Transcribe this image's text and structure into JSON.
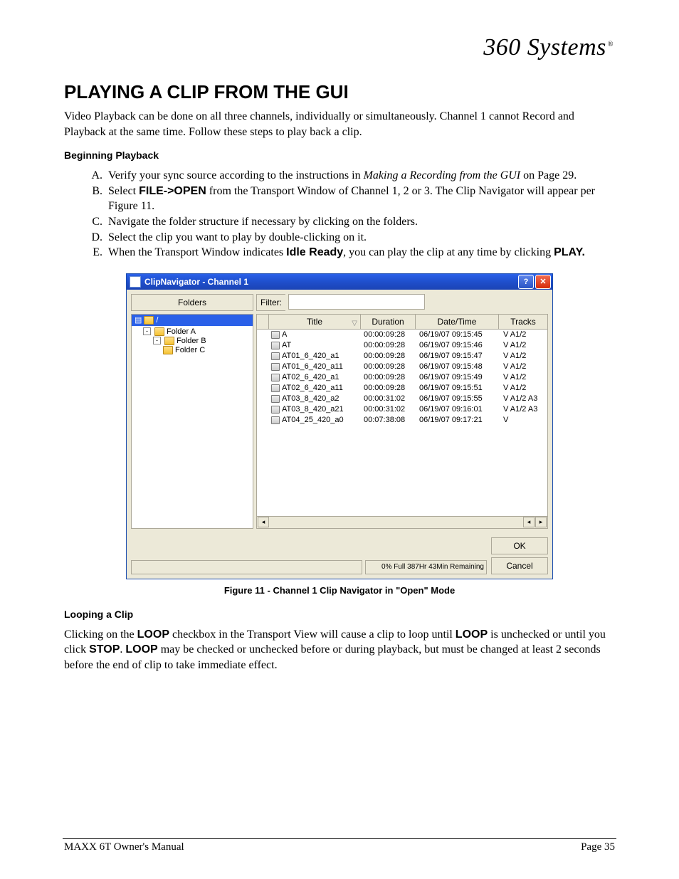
{
  "brand": "360 Systems",
  "heading": "PLAYING A CLIP FROM THE GUI",
  "intro": "Video Playback can be done on all three channels, individually or simultaneously. Channel 1 cannot Record and Playback at the same time.  Follow these steps to play back a clip.",
  "sub_begin": "Beginning Playback",
  "steps": {
    "a1": "Verify your sync source according to the instructions in ",
    "a_em": "Making a Recording from the GUI",
    "a2": " on Page 29.",
    "b1": "Select  ",
    "b_bold": "FILE->OPEN",
    "b2": " from the Transport Window of Channel 1, 2 or 3. The Clip Navigator will appear per Figure 11.",
    "c": "Navigate the folder structure if necessary by clicking on the folders.",
    "d": "Select the clip you want to play by double-clicking on it.",
    "e1": "When the Transport Window indicates ",
    "e_bold1": "Idle Ready",
    "e2": ", you can play the clip at any time by clicking ",
    "e_bold2": "PLAY."
  },
  "dialog": {
    "title": "ClipNavigator - Channel 1",
    "folders_label": "Folders",
    "filter_label": "Filter:",
    "columns": {
      "title": "Title",
      "duration": "Duration",
      "datetime": "Date/Time",
      "tracks": "Tracks"
    },
    "tree": {
      "a": "Folder A",
      "b": "Folder B",
      "c": "Folder C"
    },
    "rows": [
      {
        "title": "A",
        "duration": "00:00:09:28",
        "datetime": "06/19/07 09:15:45",
        "tracks": "V A1/2"
      },
      {
        "title": "AT",
        "duration": "00:00:09:28",
        "datetime": "06/19/07 09:15:46",
        "tracks": "V A1/2"
      },
      {
        "title": "AT01_6_420_a1",
        "duration": "00:00:09:28",
        "datetime": "06/19/07 09:15:47",
        "tracks": "V A1/2"
      },
      {
        "title": "AT01_6_420_a11",
        "duration": "00:00:09:28",
        "datetime": "06/19/07 09:15:48",
        "tracks": "V A1/2"
      },
      {
        "title": "AT02_6_420_a1",
        "duration": "00:00:09:28",
        "datetime": "06/19/07 09:15:49",
        "tracks": "V A1/2"
      },
      {
        "title": "AT02_6_420_a11",
        "duration": "00:00:09:28",
        "datetime": "06/19/07 09:15:51",
        "tracks": "V A1/2"
      },
      {
        "title": "AT03_8_420_a2",
        "duration": "00:00:31:02",
        "datetime": "06/19/07 09:15:55",
        "tracks": "V A1/2 A3"
      },
      {
        "title": "AT03_8_420_a21",
        "duration": "00:00:31:02",
        "datetime": "06/19/07 09:16:01",
        "tracks": "V A1/2 A3"
      },
      {
        "title": "AT04_25_420_a0",
        "duration": "00:07:38:08",
        "datetime": "06/19/07 09:17:21",
        "tracks": "V"
      }
    ],
    "ok": "OK",
    "cancel": "Cancel",
    "status": "0% Full  387Hr 43Min Remaining"
  },
  "fig_caption": "Figure 11 - Channel 1 Clip Navigator in \"Open\" Mode",
  "sub_loop": "Looping a Clip",
  "loop_text": {
    "p1": "Clicking on the ",
    "b1": "LOOP",
    "p2": " checkbox in the Transport View will cause a clip to loop until ",
    "b2": "LOOP",
    "p3": " is unchecked or until you click ",
    "b3": "STOP",
    "p4": ". ",
    "b4": "LOOP",
    "p5": " may be checked or unchecked before or during playback, but must be changed at least 2 seconds before the end of clip to take immediate effect."
  },
  "footer": {
    "left": "MAXX 6T Owner's Manual",
    "right": "Page 35"
  }
}
